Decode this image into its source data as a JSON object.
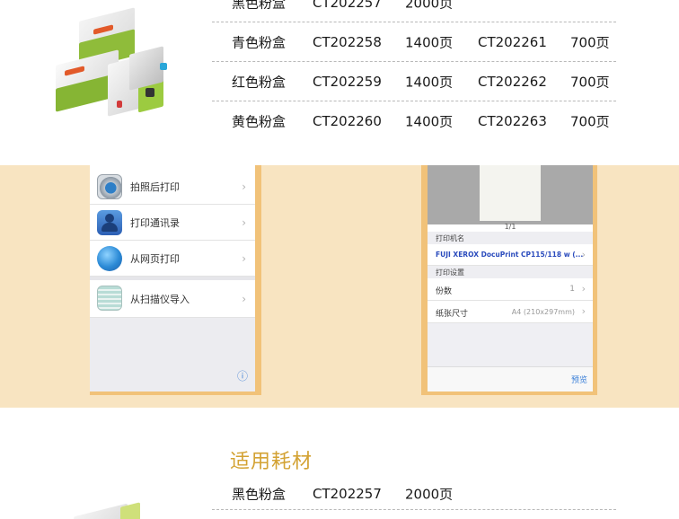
{
  "spec_table_top": [
    [
      "黑色粉盒",
      "CT202257",
      "2000页",
      "",
      ""
    ],
    [
      "青色粉盒",
      "CT202258",
      "1400页",
      "CT202261",
      "700页"
    ],
    [
      "红色粉盒",
      "CT202259",
      "1400页",
      "CT202262",
      "700页"
    ],
    [
      "黄色粉盒",
      "CT202260",
      "1400页",
      "CT202263",
      "700页"
    ]
  ],
  "left_phone": {
    "menu": [
      {
        "label": "拍照后打印",
        "icon": "camera-icon"
      },
      {
        "label": "打印通讯录",
        "icon": "contacts-icon"
      },
      {
        "label": "从网页打印",
        "icon": "globe-icon"
      },
      {
        "label": "从扫描仪导入",
        "icon": "scanner-icon"
      }
    ],
    "chevron": "›",
    "info_glyph": "ⓘ"
  },
  "right_phone": {
    "page_counter": "1/1",
    "printer_name_header": "打印机名",
    "printer_name": "FUJI XEROX DocuPrint CP115/118 w (...",
    "print_settings_header": "打印设置",
    "copies_label": "份数",
    "copies_value": "1",
    "paper_label": "纸张尺寸",
    "paper_value": "A4 (210x297mm)",
    "preview_label": "预览",
    "chevron": "›"
  },
  "section_title": "适用耗材",
  "spec_table_bottom": [
    [
      "黑色粉盒",
      "CT202257",
      "2000页",
      "",
      ""
    ]
  ],
  "colors": {
    "band": "#f8e4c1",
    "shadow": "#f1c279",
    "title": "#d3a233",
    "link_blue": "#2a4bbd"
  }
}
